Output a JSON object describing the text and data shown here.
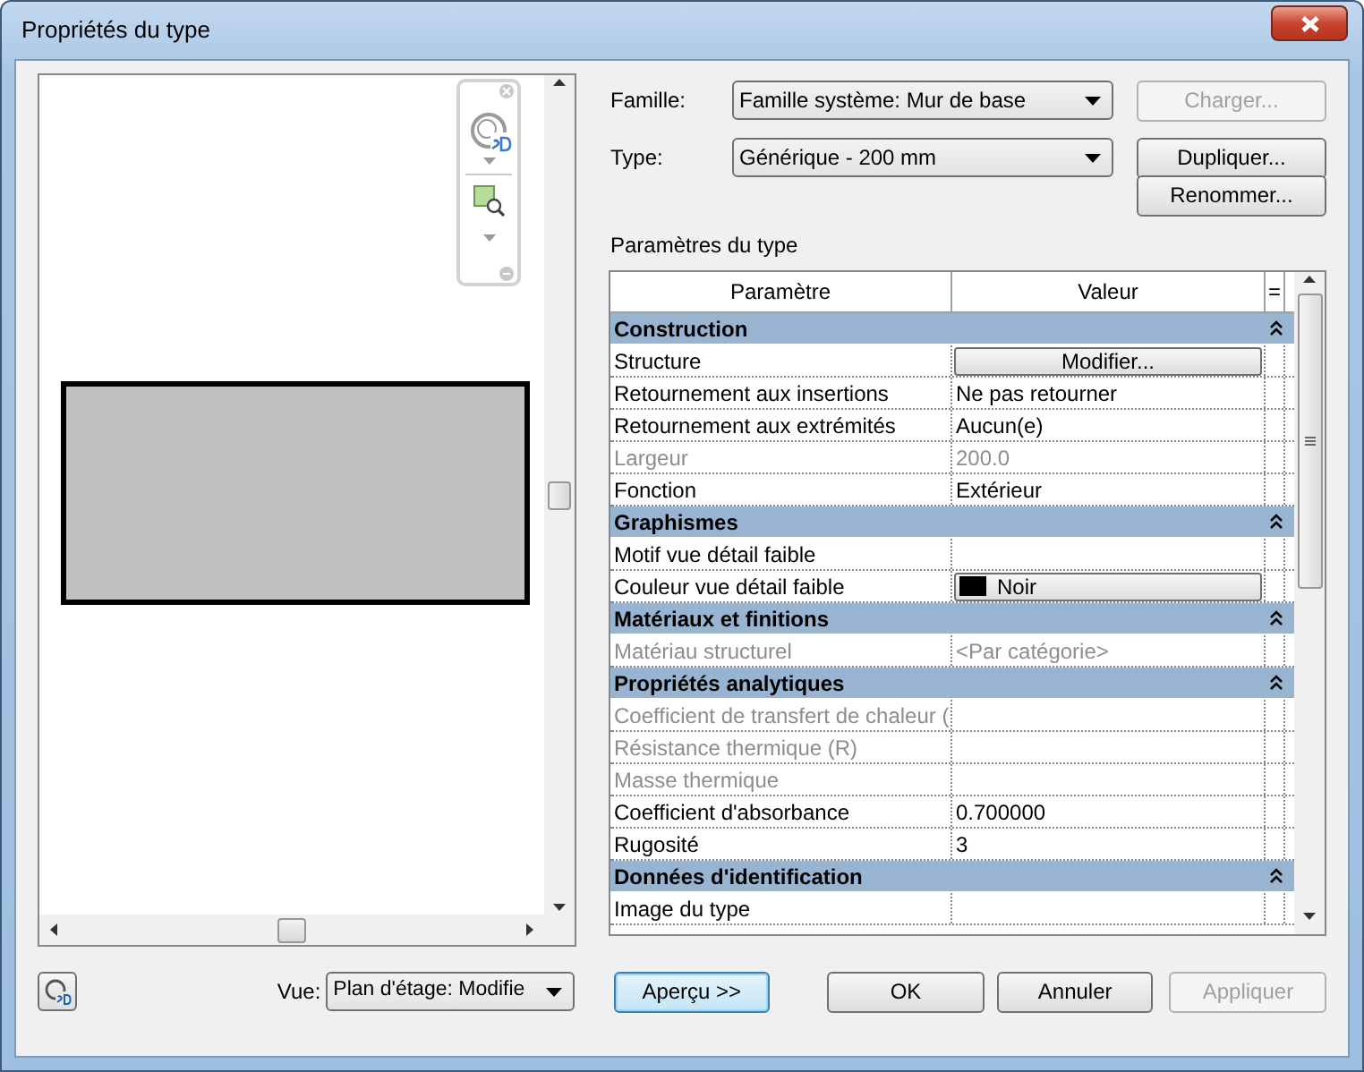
{
  "window": {
    "title": "Propriétés du type"
  },
  "family": {
    "label": "Famille:",
    "value": "Famille système: Mur de base"
  },
  "type": {
    "label": "Type:",
    "value": "Générique - 200 mm"
  },
  "side_buttons": [
    {
      "label": "Charger...",
      "disabled": true
    },
    {
      "label": "Dupliquer...",
      "disabled": false
    },
    {
      "label": "Renommer...",
      "disabled": false
    }
  ],
  "section_label": "Paramètres du type",
  "table": {
    "columns": [
      "Paramètre",
      "Valeur",
      "="
    ],
    "rows": [
      {
        "kind": "group",
        "label": "Construction",
        "expanded": true
      },
      {
        "kind": "button",
        "label": "Structure",
        "value": "Modifier...",
        "disabled": false
      },
      {
        "kind": "text",
        "label": "Retournement aux insertions",
        "value": "Ne pas retourner",
        "disabled": false
      },
      {
        "kind": "text",
        "label": "Retournement aux extrémités",
        "value": "Aucun(e)",
        "disabled": false
      },
      {
        "kind": "text",
        "label": "Largeur",
        "value": "200.0",
        "disabled": true
      },
      {
        "kind": "text",
        "label": "Fonction",
        "value": "Extérieur",
        "disabled": false
      },
      {
        "kind": "group",
        "label": "Graphismes",
        "expanded": true
      },
      {
        "kind": "blank",
        "label": "Motif vue détail faible",
        "disabled": false
      },
      {
        "kind": "color",
        "label": "Couleur vue détail faible",
        "value": "Noir",
        "color": "#000000",
        "disabled": false
      },
      {
        "kind": "group",
        "label": "Matériaux et finitions",
        "expanded": true
      },
      {
        "kind": "text",
        "label": "Matériau structurel",
        "value": "<Par catégorie>",
        "disabled": true
      },
      {
        "kind": "group",
        "label": "Propriétés analytiques",
        "expanded": true
      },
      {
        "kind": "blank",
        "label": "Coefficient de transfert de chaleur (",
        "disabled": true
      },
      {
        "kind": "blank",
        "label": "Résistance thermique (R)",
        "disabled": true
      },
      {
        "kind": "blank",
        "label": "Masse thermique",
        "disabled": true
      },
      {
        "kind": "text",
        "label": "Coefficient d'absorbance",
        "value": "0.700000",
        "disabled": false
      },
      {
        "kind": "text",
        "label": "Rugosité",
        "value": "3",
        "disabled": false
      },
      {
        "kind": "group",
        "label": "Données d'identification",
        "expanded": true
      },
      {
        "kind": "blank",
        "label": "Image du type",
        "disabled": false
      }
    ]
  },
  "footer": {
    "view_label": "Vue:",
    "view_value": "Plan d'étage: Modifie",
    "preview_button": "Aperçu >>",
    "buttons": [
      {
        "label": "OK",
        "disabled": false
      },
      {
        "label": "Annuler",
        "disabled": false
      },
      {
        "label": "Appliquer",
        "disabled": true
      }
    ]
  }
}
